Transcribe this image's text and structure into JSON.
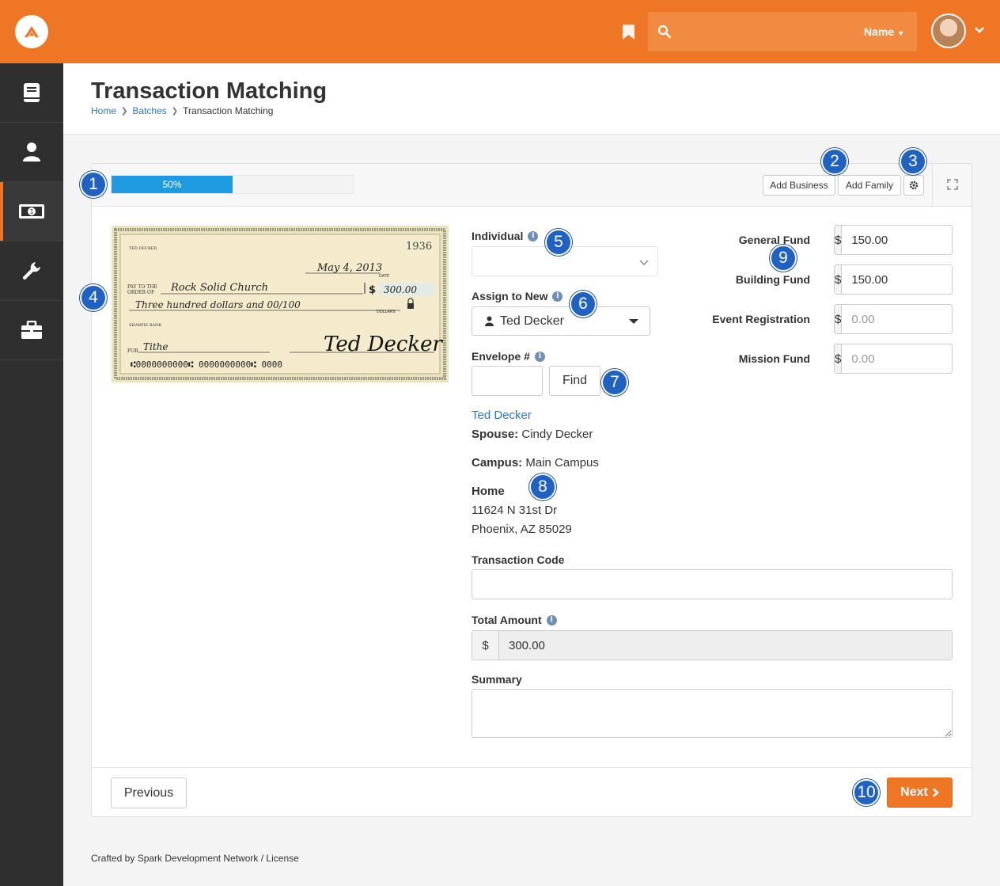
{
  "header": {
    "search_scope": "Name",
    "colors": {
      "brand": "#ee7624",
      "sidebar": "#2f2f2f",
      "link": "#2a78c2",
      "progress": "#1e9ae0",
      "callout": "#1f62c4"
    }
  },
  "sidebar": {
    "items": [
      {
        "icon": "book-icon"
      },
      {
        "icon": "person-icon"
      },
      {
        "icon": "money-icon",
        "active": true
      },
      {
        "icon": "wrench-icon"
      },
      {
        "icon": "briefcase-icon"
      }
    ]
  },
  "page": {
    "title": "Transaction Matching",
    "breadcrumb": [
      "Home",
      "Batches",
      "Transaction Matching"
    ]
  },
  "toolbar": {
    "progress_label": "50%",
    "progress_value": 0.5,
    "add_business": "Add Business",
    "add_family": "Add Family"
  },
  "check": {
    "number": "1936",
    "name_line1": "TED DECKER",
    "date": "May 4, 2013",
    "date_label": "DATE",
    "pay_to_label_1": "PAY TO THE",
    "pay_to_label_2": "ORDER OF",
    "payee": "Rock Solid Church",
    "amount": "300.00",
    "written_amount": "Three hundred dollars and 00/100",
    "dollars_label": "DOLLARS",
    "bank": "SHARPIE BANK",
    "for_label": "FOR",
    "memo": "Tithe",
    "signature": "Ted Decker",
    "micr": "⑆0000000000⑆   0000000000⑆   0000"
  },
  "form": {
    "individual_label": "Individual",
    "assign_label": "Assign to New",
    "assign_value": "Ted Decker",
    "envelope_label": "Envelope #",
    "find_label": "Find",
    "person_link": "Ted Decker",
    "spouse_label": "Spouse:",
    "spouse_value": "Cindy Decker",
    "campus_label": "Campus:",
    "campus_value": "Main Campus",
    "address_label": "Home",
    "address_line1": "11624 N 31st Dr",
    "address_line2": "Phoenix, AZ 85029",
    "transaction_code_label": "Transaction Code",
    "total_label": "Total Amount",
    "total_value": "300.00",
    "summary_label": "Summary",
    "currency": "$"
  },
  "funds": [
    {
      "label": "General Fund",
      "value": "150.00"
    },
    {
      "label": "Building Fund",
      "value": "150.00"
    },
    {
      "label": "Event Registration",
      "placeholder": "0.00"
    },
    {
      "label": "Mission Fund",
      "placeholder": "0.00"
    }
  ],
  "footer_buttons": {
    "previous": "Previous",
    "next": "Next"
  },
  "footer_text": "Crafted by Spark Development Network / License",
  "callouts": [
    "1",
    "2",
    "3",
    "4",
    "5",
    "6",
    "7",
    "8",
    "9",
    "10"
  ]
}
